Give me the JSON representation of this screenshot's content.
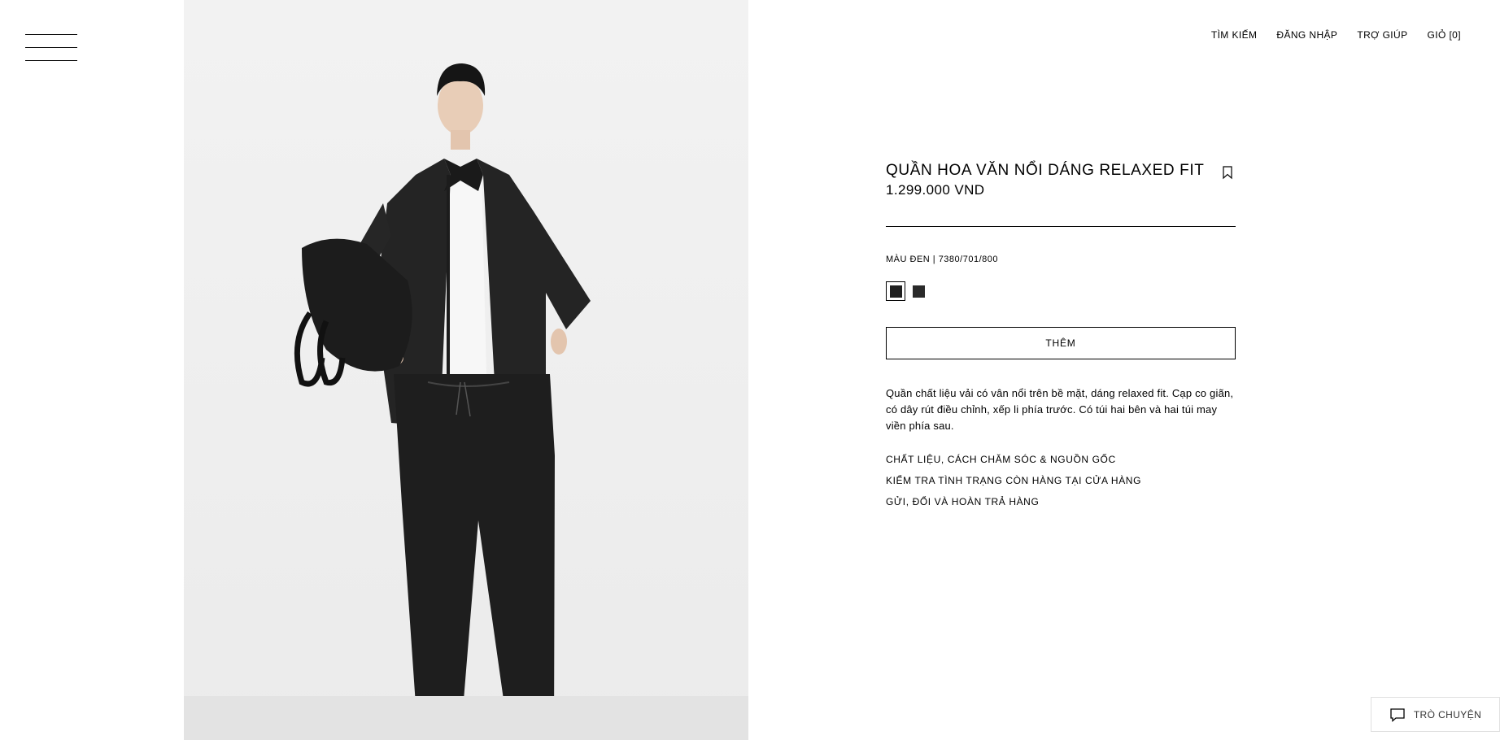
{
  "nav": {
    "search": "TÌM KIẾM",
    "login": "ĐĂNG NHẬP",
    "help": "TRỢ GIÚP",
    "cart": "GIỎ [0]"
  },
  "product": {
    "title": "QUẦN HOA VĂN NỔI DÁNG RELAXED FIT",
    "price": "1.299.000 VND",
    "color_line": "MÀU ĐEN | 7380/701/800",
    "swatch_colors": [
      "#1f1f1f",
      "#2a2a2a"
    ],
    "add_label": "THÊM",
    "description": "Quần chất liệu vải có vân nổi trên bề mặt, dáng relaxed fit. Cạp co giãn, có dây rút điều chỉnh, xếp li phía trước. Có túi hai bên và hai túi may viền phía sau."
  },
  "links": {
    "materials": "CHẤT LIỆU, CÁCH CHĂM SÓC & NGUỒN GỐC",
    "availability": "KIỂM TRA TÌNH TRẠNG CÒN HÀNG TẠI CỬA HÀNG",
    "shipping": "GỬI, ĐỔI VÀ HOÀN TRẢ HÀNG"
  },
  "chat": {
    "label": "TRÒ CHUYỆN"
  },
  "icons": {
    "menu": "hamburger-icon",
    "bookmark": "bookmark-icon",
    "chat": "chat-bubble-icon"
  }
}
